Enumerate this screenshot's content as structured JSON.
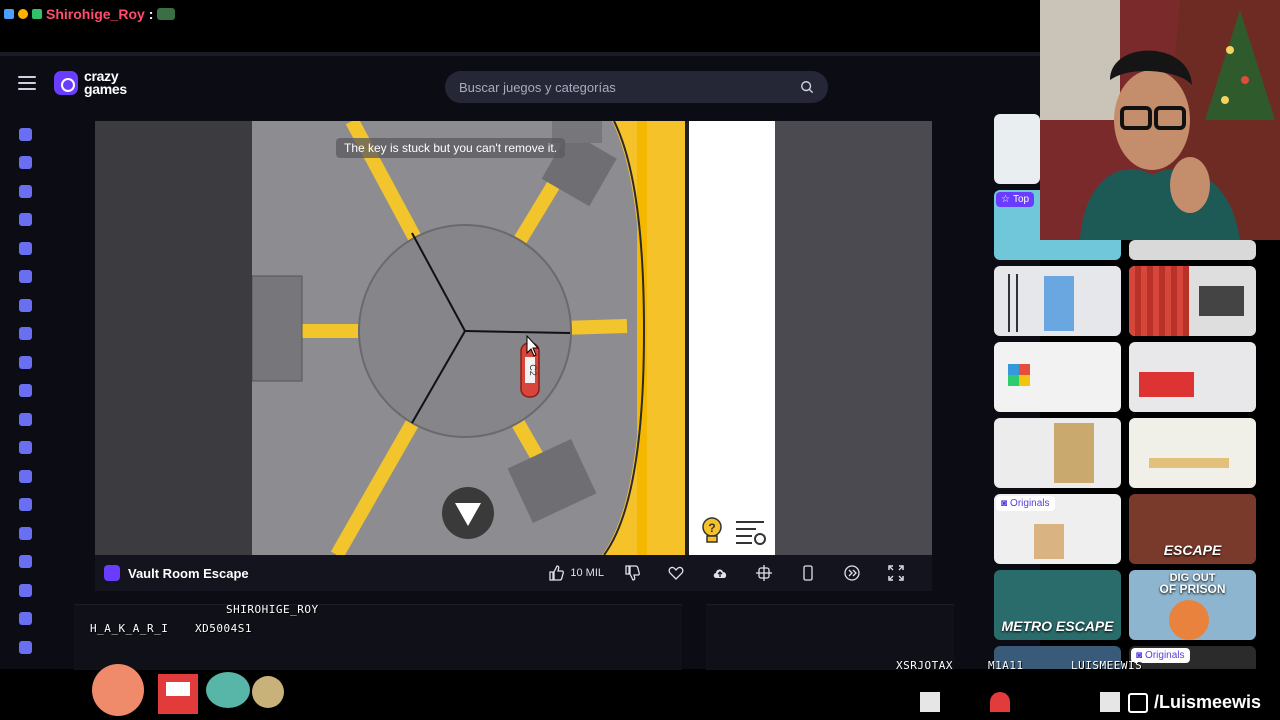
{
  "stream": {
    "chat_user": "Shirohige_Roy",
    "chat_colon": ":",
    "overlay_names": [
      "SHIROHIGE_ROY",
      "H_A_K_A_R_I",
      "XD5004S1",
      "XSRJOTAX",
      "M1A11",
      "LUISMEEWIS"
    ],
    "social_handle": "/Luismeewis",
    "colors": {
      "username": "#ff4d6d"
    }
  },
  "site": {
    "logo_line1": "crazy",
    "logo_line2": "games",
    "search_placeholder": "Buscar juegos y categorías",
    "icons": {
      "menu": "hamburger-icon",
      "search": "search-icon"
    },
    "sidebar_icons": [
      "home-icon",
      "clock-icon",
      "sparkle-icon",
      "fire-icon",
      "refresh-icon",
      "multiplayer-icon",
      "users-icon",
      "lightning-icon",
      "compass-icon",
      "basketball-icon",
      "key-icon",
      "cube-icon",
      "potion-icon",
      "rocket-icon",
      "car-icon",
      "steering-icon",
      "gamepad-icon",
      "chess-icon",
      "tag-icon"
    ],
    "colors": {
      "brand": "#6a3cff",
      "bg": "#0c0d14"
    }
  },
  "game": {
    "hint_text": "The key is stuck but you can't remove it.",
    "key_tag": "C2",
    "title": "Vault Room Escape",
    "likes": "10 MIL",
    "actions": [
      "thumbs-up-icon",
      "thumbs-down-icon",
      "heart-icon",
      "cloud-upload-icon",
      "share-icon",
      "mobile-icon",
      "theater-mode-icon",
      "fullscreen-icon"
    ]
  },
  "thumbs": {
    "top_badge": "Top",
    "originals_badge": "Originals",
    "labels": {
      "escape": "ESCAPE",
      "metro": "METRO ESCAPE",
      "dig1": "DIG OUT",
      "dig2": "OF PRISON"
    }
  }
}
